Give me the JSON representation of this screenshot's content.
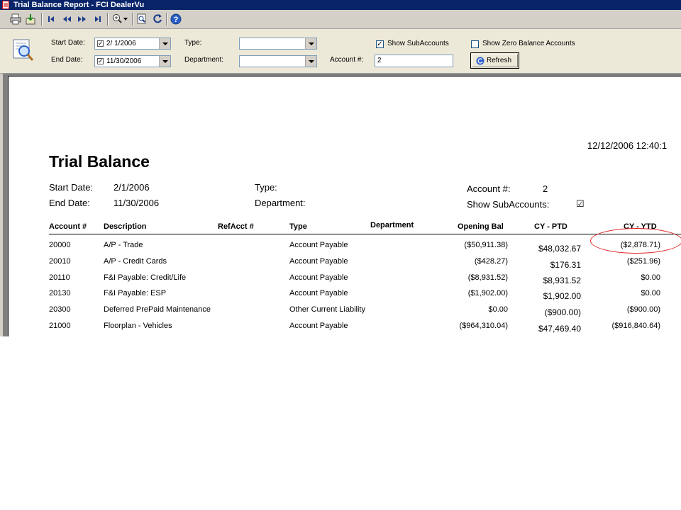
{
  "window": {
    "title": "Trial Balance Report - FCI DealerVu"
  },
  "toolbar": {
    "buttons": [
      "print-icon",
      "export-icon",
      "first-page-icon",
      "previous-page-icon",
      "next-page-icon",
      "last-page-icon",
      "zoom-icon",
      "find-icon",
      "refresh-icon",
      "help-icon"
    ]
  },
  "params": {
    "start_date_label": "Start Date:",
    "start_date_value": "2/ 1/2006",
    "end_date_label": "End Date:",
    "end_date_value": "11/30/2006",
    "type_label": "Type:",
    "type_value": "",
    "department_label": "Department:",
    "department_value": "",
    "account_label": "Account #:",
    "account_value": "2",
    "show_subaccounts_label": "Show SubAccounts",
    "show_subaccounts_checked": true,
    "show_zero_label": "Show Zero Balance Accounts",
    "show_zero_checked": false,
    "refresh_label": "Refresh"
  },
  "report": {
    "timestamp": "12/12/2006   12:40:1",
    "title": "Trial Balance",
    "start_date_label": "Start Date:",
    "start_date_value": "2/1/2006",
    "end_date_label": "End Date:",
    "end_date_value": "11/30/2006",
    "type_label": "Type:",
    "department_label": "Department:",
    "account_label": "Account #:",
    "account_value": "2",
    "show_subaccounts_label": "Show SubAccounts:",
    "show_subaccounts_mark": "☑",
    "columns": {
      "account": "Account #",
      "description": "Description",
      "refacct": "RefAcct #",
      "type": "Type",
      "department": "Department",
      "opening": "Opening Bal",
      "ptd": "CY - PTD",
      "ytd": "CY - YTD"
    },
    "rows": [
      {
        "account": "20000",
        "description": "A/P - Trade",
        "refacct": "",
        "type": "Account Payable",
        "department": "",
        "opening": "($50,911.38)",
        "ptd": "$48,032.67",
        "ytd": "($2,878.71)"
      },
      {
        "account": "20010",
        "description": "A/P - Credit Cards",
        "refacct": "",
        "type": "Account Payable",
        "department": "",
        "opening": "($428.27)",
        "ptd": "$176.31",
        "ytd": "($251.96)"
      },
      {
        "account": "20110",
        "description": "F&I Payable: Credit/Life",
        "refacct": "",
        "type": "Account Payable",
        "department": "",
        "opening": "($8,931.52)",
        "ptd": "$8,931.52",
        "ytd": "$0.00"
      },
      {
        "account": "20130",
        "description": "F&I Payable: ESP",
        "refacct": "",
        "type": "Account Payable",
        "department": "",
        "opening": "($1,902.00)",
        "ptd": "$1,902.00",
        "ytd": "$0.00"
      },
      {
        "account": "20300",
        "description": "Deferred PrePaid Maintenance",
        "refacct": "",
        "type": "Other Current Liability",
        "department": "",
        "opening": "$0.00",
        "ptd": "($900.00)",
        "ytd": "($900.00)"
      },
      {
        "account": "21000",
        "description": "Floorplan - Vehicles",
        "refacct": "",
        "type": "Account Payable",
        "department": "",
        "opening": "($964,310.04)",
        "ptd": "$47,469.40",
        "ytd": "($916,840.64)"
      }
    ],
    "annotation_color": "#e02020"
  }
}
